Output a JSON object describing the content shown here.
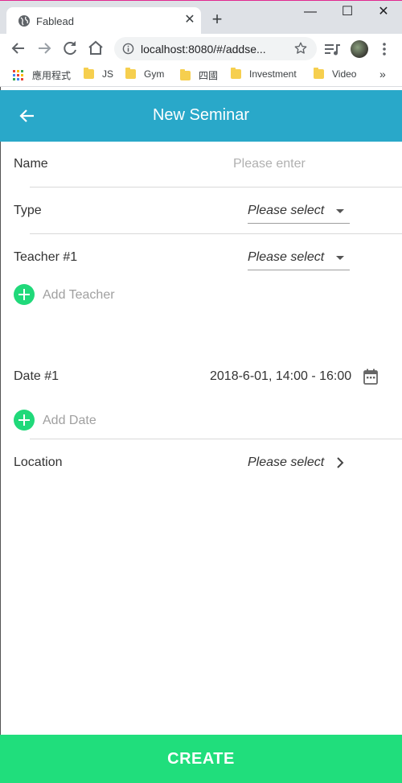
{
  "browser": {
    "tab_title": "Fablead",
    "tab_close": "✕",
    "new_tab": "+",
    "window_controls": {
      "minimize": "—",
      "maximize": "☐",
      "close": "✕"
    },
    "url": "localhost:8080/#/addse...",
    "bookmarks": {
      "apps_label": "應用程式",
      "folders": [
        "JS",
        "Gym",
        "四國",
        "Investment",
        "Video"
      ],
      "more": "»"
    },
    "icons": [
      "globe-icon",
      "back-icon",
      "forward-icon",
      "reload-icon",
      "home-icon",
      "info-icon",
      "star-icon",
      "media-icon",
      "avatar",
      "kebab-menu-icon"
    ]
  },
  "app": {
    "title": "New Seminar",
    "accent": "#29a8c9",
    "action_color": "#20de7c",
    "form": {
      "name_label": "Name",
      "name_placeholder": "Please enter",
      "type_label": "Type",
      "type_value": "Please select",
      "teacher_label": "Teacher #1",
      "teacher_value": "Please select",
      "add_teacher": "Add Teacher",
      "date_label": "Date #1",
      "date_value": "2018-6-01, 14:00 - 16:00",
      "add_date": "Add Date",
      "location_label": "Location",
      "location_value": "Please select"
    },
    "create_button": "CREATE"
  }
}
